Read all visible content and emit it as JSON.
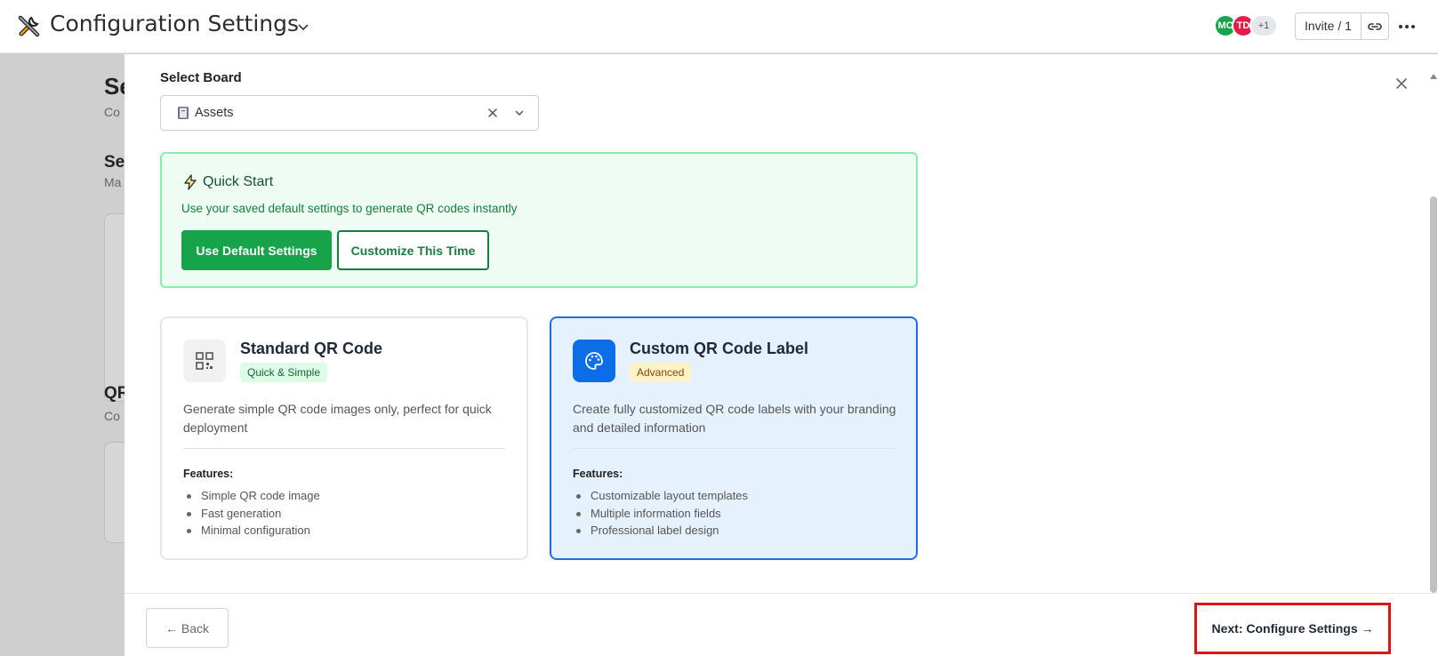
{
  "header": {
    "app_title": "Configuration Settings",
    "avatars": [
      {
        "initials": "MC",
        "color": "#16a34a"
      },
      {
        "initials": "TD",
        "color": "#e11d48"
      }
    ],
    "avatar_more": "+1",
    "invite_label": "Invite / 1"
  },
  "background": {
    "h1": "Se",
    "sub1": "Co",
    "h2": "Se",
    "sub2": "Ma",
    "h3": "QR",
    "sub3": "Co"
  },
  "modal": {
    "board_label": "Select Board",
    "board_value": "Assets",
    "quick_start": {
      "title": "Quick Start",
      "description": "Use your saved default settings to generate QR codes instantly",
      "primary_button": "Use Default Settings",
      "secondary_button": "Customize This Time"
    },
    "cards": {
      "standard": {
        "title": "Standard QR Code",
        "badge": "Quick & Simple",
        "description": "Generate simple QR code images only, perfect for quick deployment",
        "features_label": "Features:",
        "features": [
          "Simple QR code image",
          "Fast generation",
          "Minimal configuration"
        ]
      },
      "custom": {
        "title": "Custom QR Code Label",
        "badge": "Advanced",
        "description": "Create fully customized QR code labels with your branding and detailed information",
        "features_label": "Features:",
        "features": [
          "Customizable layout templates",
          "Multiple information fields",
          "Professional label design"
        ]
      }
    },
    "footer": {
      "back_label": "← Back",
      "next_label": "Next: Configure Settings →"
    }
  },
  "colors": {
    "accent_green": "#16a34a",
    "accent_blue": "#0b6ee8",
    "highlight_red": "#e11414"
  }
}
